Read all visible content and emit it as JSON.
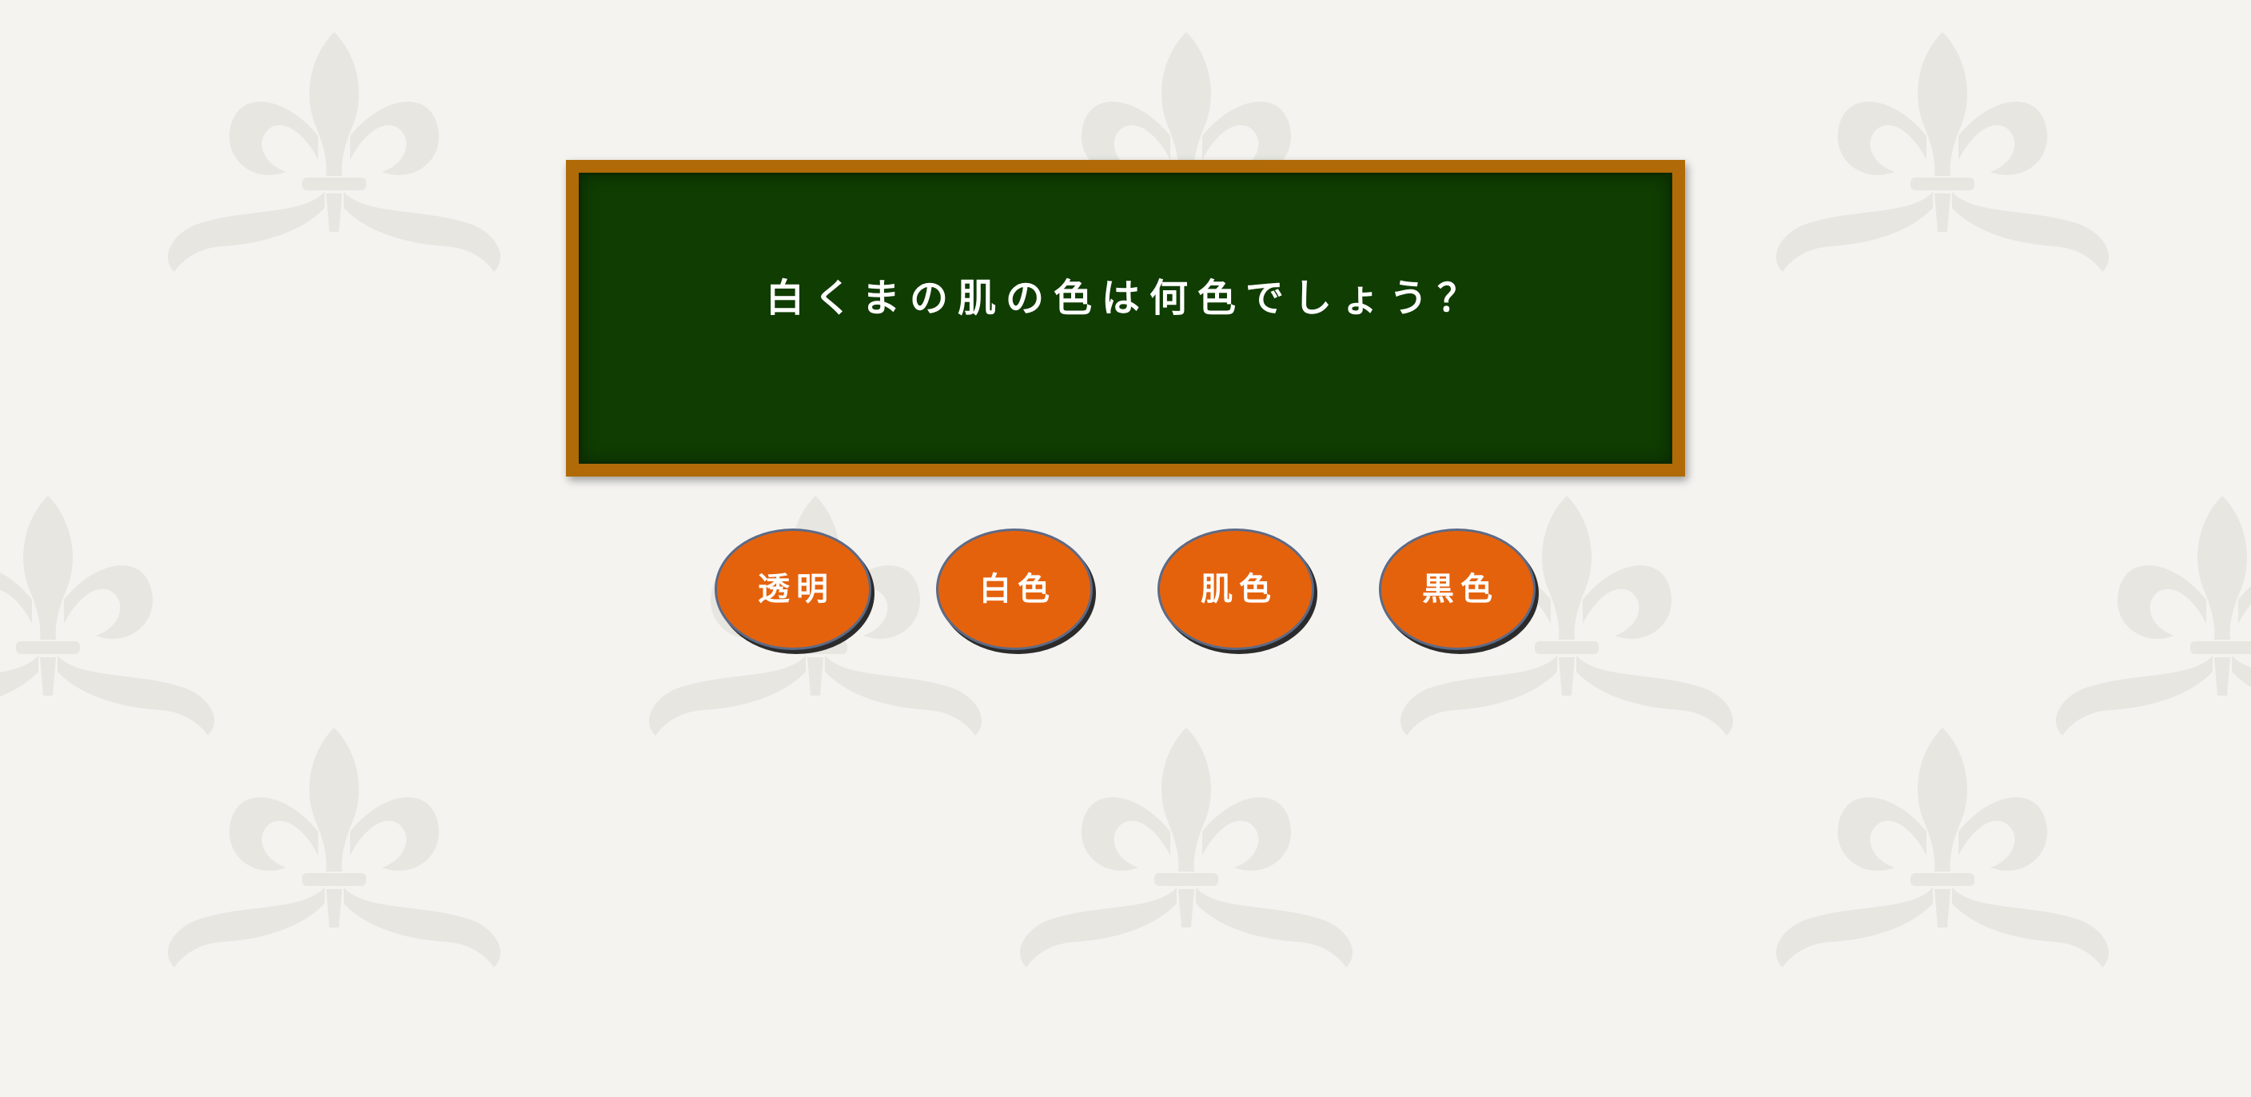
{
  "quiz": {
    "question": "白くまの肌の色は何色でしょう？",
    "answers": [
      {
        "label": "透明"
      },
      {
        "label": "白色"
      },
      {
        "label": "肌色"
      },
      {
        "label": "黒色"
      }
    ]
  },
  "colors": {
    "page_background": "#f4f3f0",
    "wallpaper_motif": "#e6e5df",
    "board_surface": "#0f3d02",
    "board_frame": "#b06a08",
    "answer_button": "#e5620c",
    "answer_button_border": "#5d6a86",
    "text": "#ffffff"
  },
  "icons": {
    "wallpaper_motif": "fleur-de-lis-icon"
  }
}
